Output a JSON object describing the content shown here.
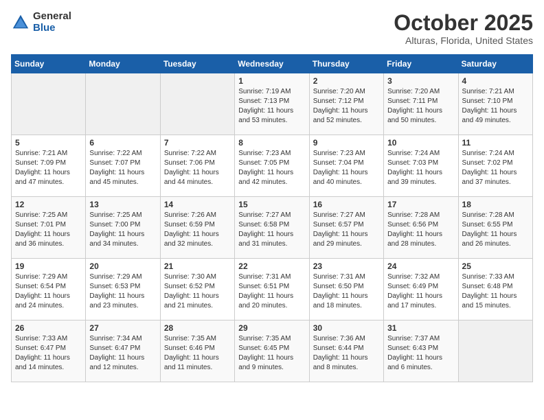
{
  "logo": {
    "general": "General",
    "blue": "Blue"
  },
  "title": "October 2025",
  "location": "Alturas, Florida, United States",
  "days_of_week": [
    "Sunday",
    "Monday",
    "Tuesday",
    "Wednesday",
    "Thursday",
    "Friday",
    "Saturday"
  ],
  "weeks": [
    [
      {
        "day": "",
        "info": ""
      },
      {
        "day": "",
        "info": ""
      },
      {
        "day": "",
        "info": ""
      },
      {
        "day": "1",
        "info": "Sunrise: 7:19 AM\nSunset: 7:13 PM\nDaylight: 11 hours\nand 53 minutes."
      },
      {
        "day": "2",
        "info": "Sunrise: 7:20 AM\nSunset: 7:12 PM\nDaylight: 11 hours\nand 52 minutes."
      },
      {
        "day": "3",
        "info": "Sunrise: 7:20 AM\nSunset: 7:11 PM\nDaylight: 11 hours\nand 50 minutes."
      },
      {
        "day": "4",
        "info": "Sunrise: 7:21 AM\nSunset: 7:10 PM\nDaylight: 11 hours\nand 49 minutes."
      }
    ],
    [
      {
        "day": "5",
        "info": "Sunrise: 7:21 AM\nSunset: 7:09 PM\nDaylight: 11 hours\nand 47 minutes."
      },
      {
        "day": "6",
        "info": "Sunrise: 7:22 AM\nSunset: 7:07 PM\nDaylight: 11 hours\nand 45 minutes."
      },
      {
        "day": "7",
        "info": "Sunrise: 7:22 AM\nSunset: 7:06 PM\nDaylight: 11 hours\nand 44 minutes."
      },
      {
        "day": "8",
        "info": "Sunrise: 7:23 AM\nSunset: 7:05 PM\nDaylight: 11 hours\nand 42 minutes."
      },
      {
        "day": "9",
        "info": "Sunrise: 7:23 AM\nSunset: 7:04 PM\nDaylight: 11 hours\nand 40 minutes."
      },
      {
        "day": "10",
        "info": "Sunrise: 7:24 AM\nSunset: 7:03 PM\nDaylight: 11 hours\nand 39 minutes."
      },
      {
        "day": "11",
        "info": "Sunrise: 7:24 AM\nSunset: 7:02 PM\nDaylight: 11 hours\nand 37 minutes."
      }
    ],
    [
      {
        "day": "12",
        "info": "Sunrise: 7:25 AM\nSunset: 7:01 PM\nDaylight: 11 hours\nand 36 minutes."
      },
      {
        "day": "13",
        "info": "Sunrise: 7:25 AM\nSunset: 7:00 PM\nDaylight: 11 hours\nand 34 minutes."
      },
      {
        "day": "14",
        "info": "Sunrise: 7:26 AM\nSunset: 6:59 PM\nDaylight: 11 hours\nand 32 minutes."
      },
      {
        "day": "15",
        "info": "Sunrise: 7:27 AM\nSunset: 6:58 PM\nDaylight: 11 hours\nand 31 minutes."
      },
      {
        "day": "16",
        "info": "Sunrise: 7:27 AM\nSunset: 6:57 PM\nDaylight: 11 hours\nand 29 minutes."
      },
      {
        "day": "17",
        "info": "Sunrise: 7:28 AM\nSunset: 6:56 PM\nDaylight: 11 hours\nand 28 minutes."
      },
      {
        "day": "18",
        "info": "Sunrise: 7:28 AM\nSunset: 6:55 PM\nDaylight: 11 hours\nand 26 minutes."
      }
    ],
    [
      {
        "day": "19",
        "info": "Sunrise: 7:29 AM\nSunset: 6:54 PM\nDaylight: 11 hours\nand 24 minutes."
      },
      {
        "day": "20",
        "info": "Sunrise: 7:29 AM\nSunset: 6:53 PM\nDaylight: 11 hours\nand 23 minutes."
      },
      {
        "day": "21",
        "info": "Sunrise: 7:30 AM\nSunset: 6:52 PM\nDaylight: 11 hours\nand 21 minutes."
      },
      {
        "day": "22",
        "info": "Sunrise: 7:31 AM\nSunset: 6:51 PM\nDaylight: 11 hours\nand 20 minutes."
      },
      {
        "day": "23",
        "info": "Sunrise: 7:31 AM\nSunset: 6:50 PM\nDaylight: 11 hours\nand 18 minutes."
      },
      {
        "day": "24",
        "info": "Sunrise: 7:32 AM\nSunset: 6:49 PM\nDaylight: 11 hours\nand 17 minutes."
      },
      {
        "day": "25",
        "info": "Sunrise: 7:33 AM\nSunset: 6:48 PM\nDaylight: 11 hours\nand 15 minutes."
      }
    ],
    [
      {
        "day": "26",
        "info": "Sunrise: 7:33 AM\nSunset: 6:47 PM\nDaylight: 11 hours\nand 14 minutes."
      },
      {
        "day": "27",
        "info": "Sunrise: 7:34 AM\nSunset: 6:47 PM\nDaylight: 11 hours\nand 12 minutes."
      },
      {
        "day": "28",
        "info": "Sunrise: 7:35 AM\nSunset: 6:46 PM\nDaylight: 11 hours\nand 11 minutes."
      },
      {
        "day": "29",
        "info": "Sunrise: 7:35 AM\nSunset: 6:45 PM\nDaylight: 11 hours\nand 9 minutes."
      },
      {
        "day": "30",
        "info": "Sunrise: 7:36 AM\nSunset: 6:44 PM\nDaylight: 11 hours\nand 8 minutes."
      },
      {
        "day": "31",
        "info": "Sunrise: 7:37 AM\nSunset: 6:43 PM\nDaylight: 11 hours\nand 6 minutes."
      },
      {
        "day": "",
        "info": ""
      }
    ]
  ]
}
